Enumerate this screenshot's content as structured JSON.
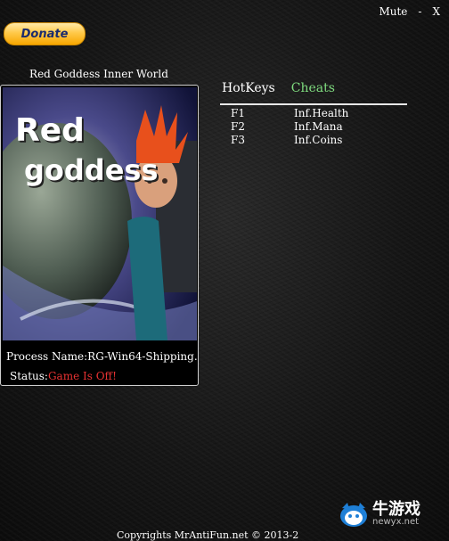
{
  "topbar": {
    "mute": "Mute",
    "minimize": "-",
    "close": "X"
  },
  "donate": {
    "label": "Donate"
  },
  "game": {
    "title": "Red Goddess Inner World",
    "logo_line1": "Red",
    "logo_line2": "goddess"
  },
  "process": {
    "label": "Process Name:",
    "value": "RG-Win64-Shipping."
  },
  "status": {
    "label": "Status:",
    "value": "Game Is Off!"
  },
  "tabs": {
    "hotkeys": "HotKeys",
    "cheats": "Cheats"
  },
  "cheats": [
    {
      "key": "F1",
      "name": "Inf.Health"
    },
    {
      "key": "F2",
      "name": "Inf.Mana"
    },
    {
      "key": "F3",
      "name": "Inf.Coins"
    }
  ],
  "footer": {
    "copyright": "Copyrights MrAntiFun.net © 2013-2"
  },
  "watermark": {
    "cn": "牛游戏",
    "url": "newyx.net"
  },
  "colors": {
    "accent_green": "#7fdc7f",
    "status_red": "#e83232",
    "donate_gold": "#ffc94a"
  }
}
